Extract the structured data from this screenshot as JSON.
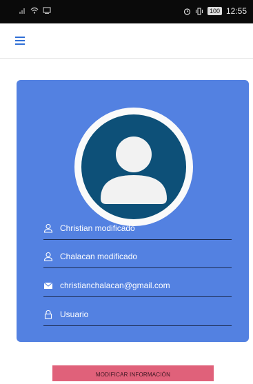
{
  "status_bar": {
    "time": "12:55",
    "battery": "100",
    "icons": [
      "signal-icon",
      "wifi-icon",
      "cast-icon",
      "alarm-icon",
      "vibrate-icon",
      "battery-icon"
    ]
  },
  "app_bar": {
    "menu_icon": "hamburger-menu-icon"
  },
  "profile": {
    "avatar_icon": "user-avatar-icon",
    "first_name": "Christian modificado",
    "last_name": "Chalacan modificado",
    "email": "christianchalacan@gmail.com",
    "role": "Usuario"
  },
  "actions": {
    "modify_label": "MODIFICAR INFORMACIÓN"
  },
  "colors": {
    "card": "#5381e1",
    "avatar_bg": "#0d5078",
    "button": "#e0617a",
    "accent": "#2f6fd6"
  }
}
